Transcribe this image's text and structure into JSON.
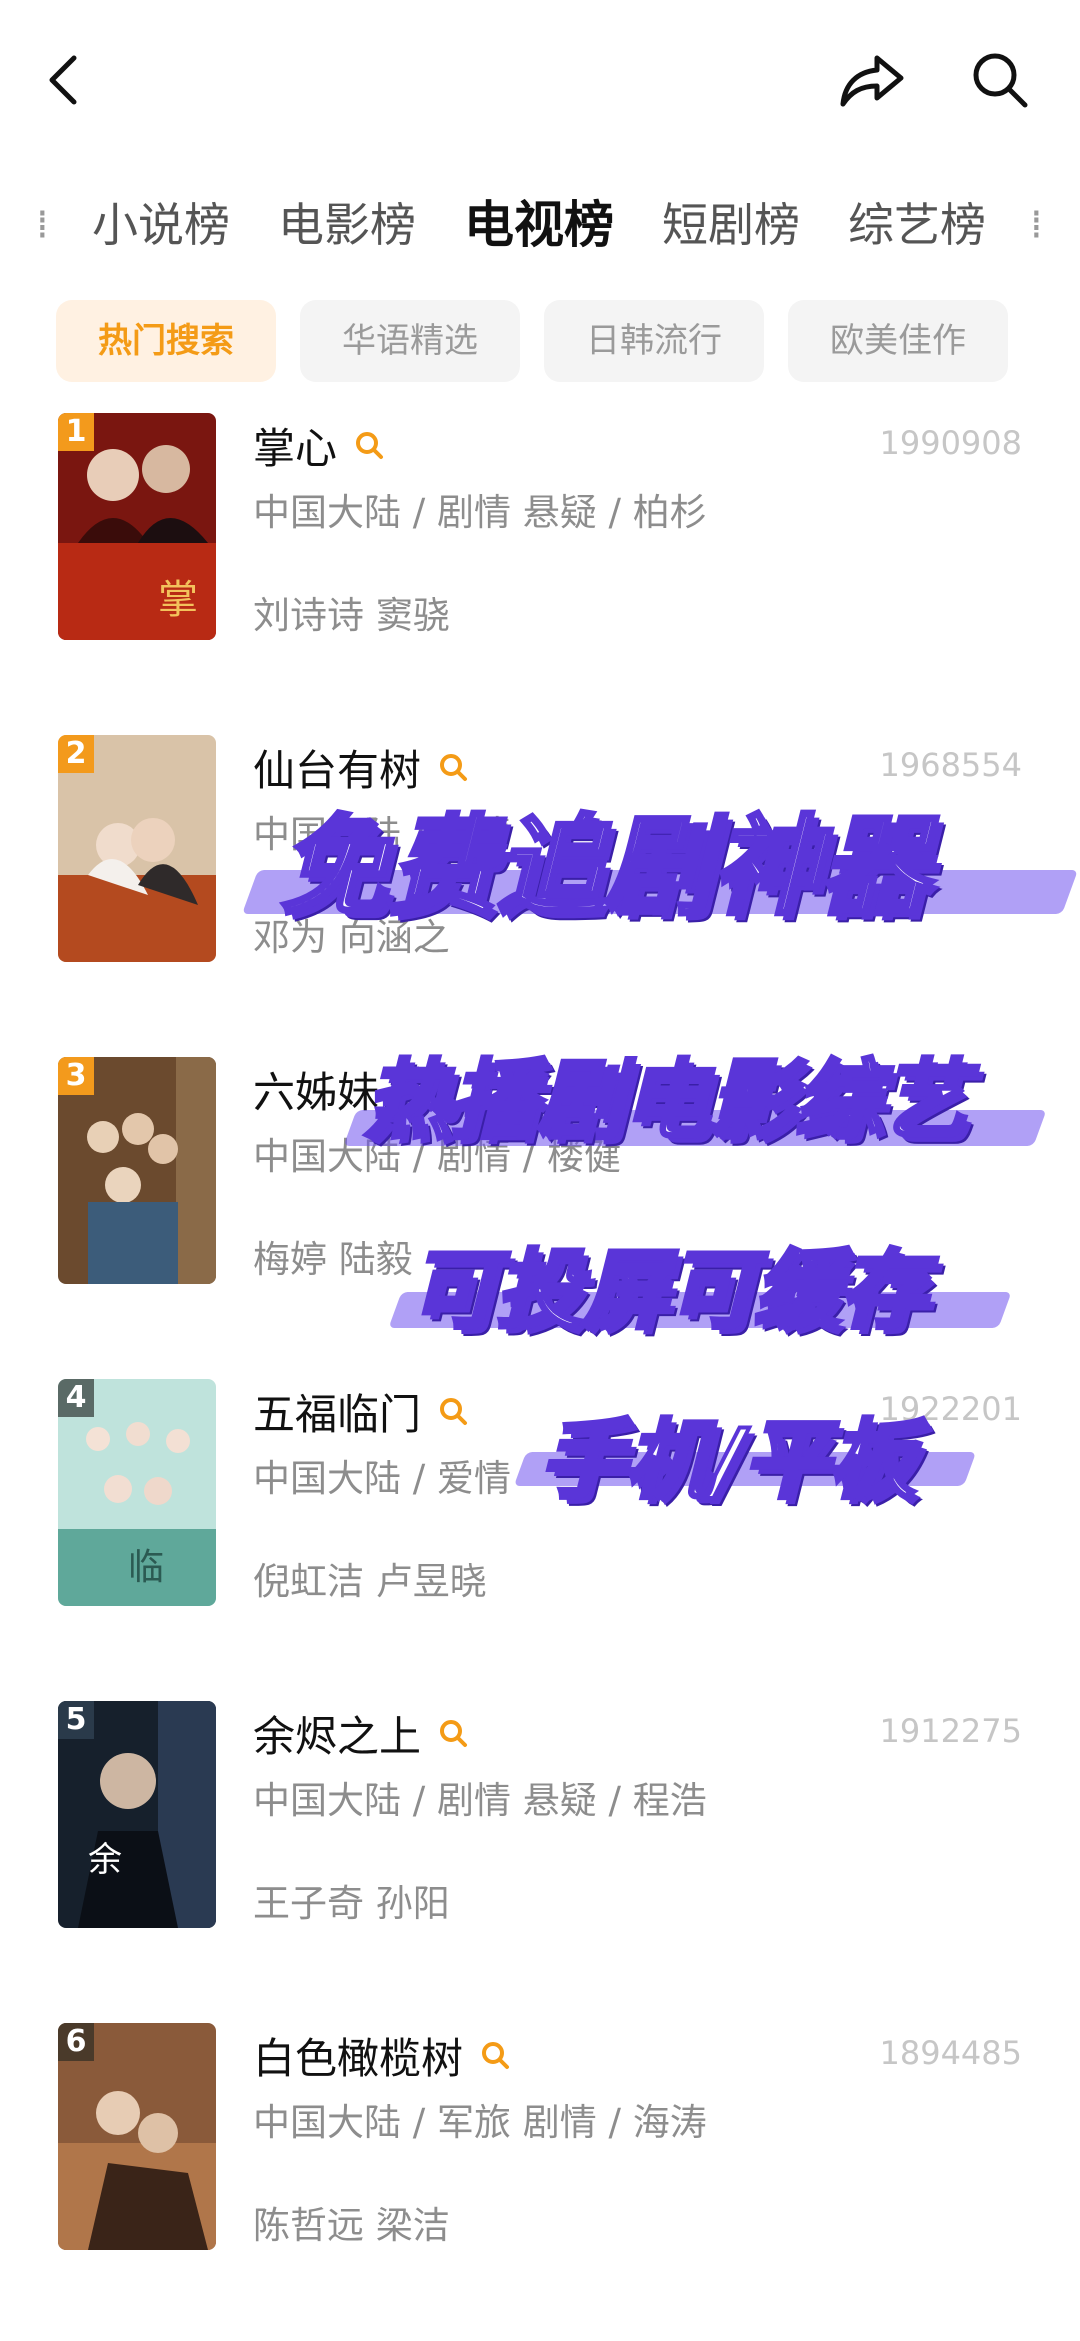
{
  "header": {
    "back_icon": "chevron-left-icon",
    "share_icon": "share-icon",
    "search_icon": "search-icon"
  },
  "tabs": [
    {
      "label": "小说榜"
    },
    {
      "label": "电影榜"
    },
    {
      "label": "电视榜",
      "active": true
    },
    {
      "label": "短剧榜"
    },
    {
      "label": "综艺榜"
    }
  ],
  "chips": [
    {
      "label": "热门搜索",
      "active": true
    },
    {
      "label": "华语精选"
    },
    {
      "label": "日韩流行"
    },
    {
      "label": "欧美佳作"
    }
  ],
  "items": [
    {
      "rank": "1",
      "title": "掌心",
      "hot": "1990908",
      "meta": "中国大陆 / 剧情 悬疑 / 柏杉",
      "cast": "刘诗诗 窦骁",
      "rank_color": "#f39a1c"
    },
    {
      "rank": "2",
      "title": "仙台有树",
      "hot": "1968554",
      "meta": "中国大陆 / 剧情",
      "cast": "邓为 向涵之",
      "rank_color": "#f39a1c"
    },
    {
      "rank": "3",
      "title": "六姊妹",
      "hot": "",
      "meta": "中国大陆 / 剧情 / 楼健",
      "cast": "梅婷 陆毅",
      "rank_color": "#f39a1c"
    },
    {
      "rank": "4",
      "title": "五福临门",
      "hot": "1922201",
      "meta": "中国大陆 / 爱情",
      "cast": "倪虹洁 卢昱晓",
      "rank_color": "#5a6a66"
    },
    {
      "rank": "5",
      "title": "余烬之上",
      "hot": "1912275",
      "meta": "中国大陆 / 剧情 悬疑 / 程浩",
      "cast": "王子奇 孙阳",
      "rank_color": "#2a3a4a"
    },
    {
      "rank": "6",
      "title": "白色橄榄树",
      "hot": "1894485",
      "meta": "中国大陆 / 军旅 剧情 / 海涛",
      "cast": "陈哲远 梁洁",
      "rank_color": "#4a3a2a"
    }
  ],
  "promo": {
    "line1": "免费追剧神器",
    "line2": "热播剧电影综艺",
    "line3": "可投屏可缓存",
    "line4": "手机/平板"
  },
  "colors": {
    "accent": "#f49b16",
    "promo_purple": "#5a35d8"
  }
}
